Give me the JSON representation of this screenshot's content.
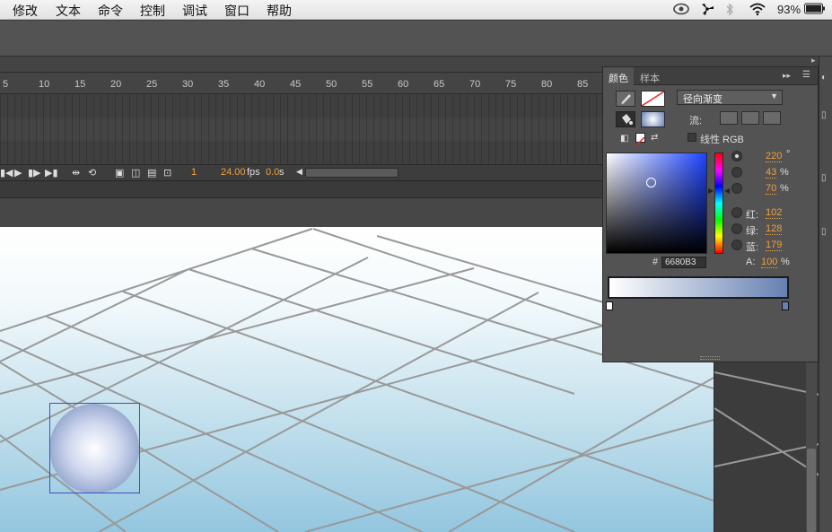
{
  "menubar": {
    "items": [
      "修改",
      "文本",
      "命令",
      "控制",
      "调试",
      "窗口",
      "帮助"
    ],
    "battery": "93%"
  },
  "timeline": {
    "ruler_ticks": [
      "5",
      "10",
      "15",
      "20",
      "25",
      "30",
      "35",
      "40",
      "45",
      "50",
      "55",
      "60",
      "65",
      "70",
      "75",
      "80",
      "85"
    ],
    "current_frame": "1",
    "fps_value": "24.00",
    "fps_unit": "fps",
    "time_value": "0.0",
    "time_unit": "s"
  },
  "color_panel": {
    "tabs": [
      "颜色",
      "样本"
    ],
    "fill_type": "径向渐变",
    "flow_label": "流:",
    "linear_rgb_label": "线性 RGB",
    "hsb": [
      {
        "value": "220",
        "unit": "°"
      },
      {
        "value": "43",
        "unit": "%"
      },
      {
        "value": "70",
        "unit": "%"
      }
    ],
    "rgb": [
      {
        "label": "红:",
        "value": "102"
      },
      {
        "label": "绿:",
        "value": "128"
      },
      {
        "label": "蓝:",
        "value": "179"
      }
    ],
    "hex_label": "#",
    "hex_value": "6680B3",
    "alpha_label": "A:",
    "alpha_value": "100",
    "alpha_unit": "%",
    "colors": {
      "gradient_start": "#ffffff",
      "gradient_end": "#6680b3"
    }
  },
  "icons": {
    "stroke": "pencil-icon",
    "fill": "paint-bucket-icon",
    "controls": [
      "first-frame-icon",
      "play-icon",
      "step-forward-icon",
      "last-frame-icon"
    ]
  }
}
